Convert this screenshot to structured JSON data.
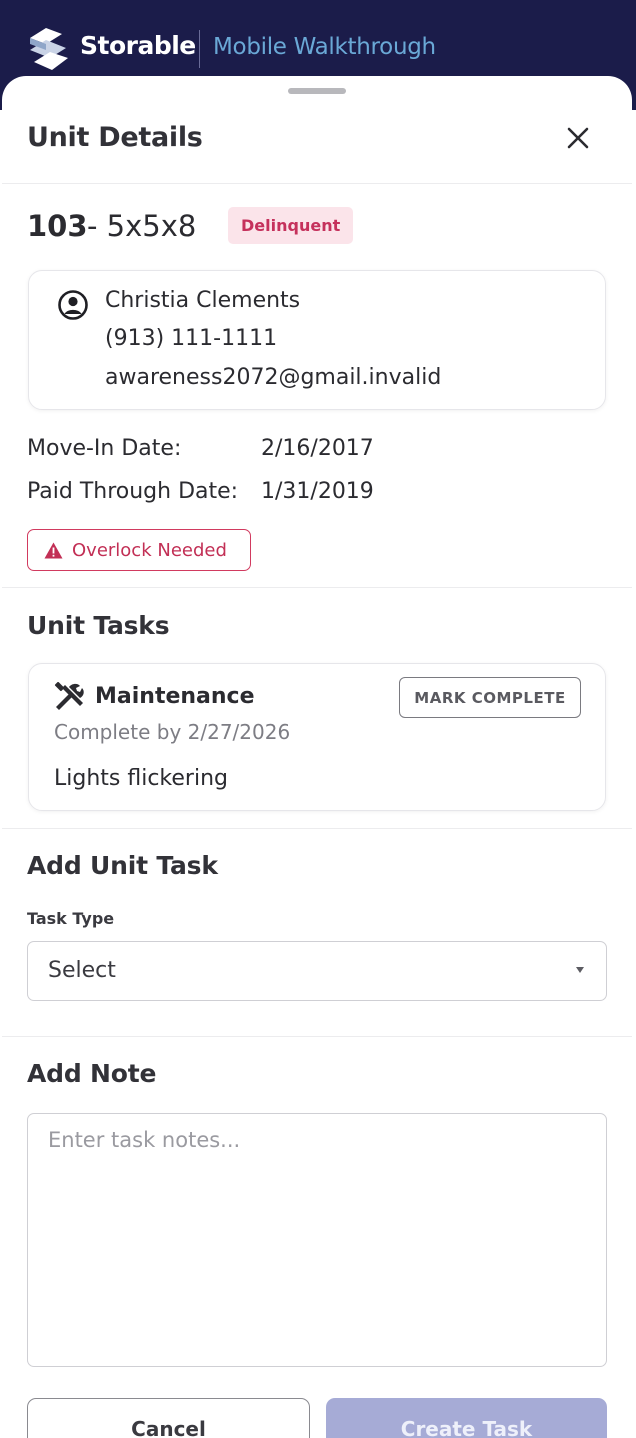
{
  "header": {
    "brand": "Storable",
    "subtitle": "Mobile Walkthrough"
  },
  "sheet": {
    "title": "Unit Details"
  },
  "unit": {
    "number": "103",
    "size": "- 5x5x8",
    "status_badge": "Delinquent"
  },
  "tenant": {
    "name": "Christia Clements",
    "phone": "(913) 111-1111",
    "email": "awareness2072@gmail.invalid"
  },
  "dates": {
    "move_in_label": "Move-In Date:",
    "move_in_value": "2/16/2017",
    "paid_through_label": "Paid Through Date:",
    "paid_through_value": "1/31/2019"
  },
  "alert": {
    "label": "Overlock Needed"
  },
  "unit_tasks": {
    "title": "Unit Tasks",
    "tasks": [
      {
        "type": "Maintenance",
        "due": "Complete by 2/27/2026",
        "description": "Lights flickering",
        "action_label": "MARK COMPLETE"
      }
    ]
  },
  "add_task": {
    "title": "Add Unit Task",
    "field_label": "Task Type",
    "selected": "Select"
  },
  "add_note": {
    "title": "Add Note",
    "placeholder": "Enter task notes..."
  },
  "actions": {
    "cancel": "Cancel",
    "create": "Create Task"
  },
  "colors": {
    "header_bg": "#1b1c4a",
    "accent_blue": "#6aa8d6",
    "danger": "#c5315c",
    "badge_bg": "#fbe4ea",
    "primary_disabled": "#a6abd6"
  },
  "icons": {
    "logo": "storable-logo-icon",
    "close": "close-icon",
    "person": "person-circle-icon",
    "alert": "warning-triangle-icon",
    "task": "tools-icon",
    "caret": "caret-down-icon"
  }
}
